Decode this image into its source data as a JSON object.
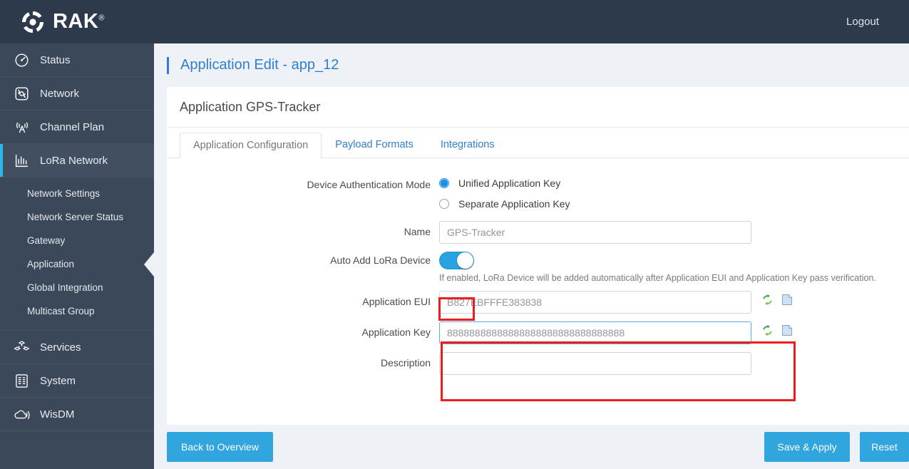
{
  "topbar": {
    "brand": "RAK",
    "brand_mark": "®",
    "logo_icon": "rak-swirl-logo-icon",
    "logout_label": "Logout"
  },
  "sidebar": {
    "items": [
      {
        "label": "Status",
        "icon": "speedometer-icon",
        "active": false
      },
      {
        "label": "Network",
        "icon": "globe-network-icon",
        "active": false
      },
      {
        "label": "Channel Plan",
        "icon": "antenna-tower-icon",
        "active": false
      },
      {
        "label": "LoRa Network",
        "icon": "bar-chart-icon",
        "active": true
      },
      {
        "label": "Services",
        "icon": "cubes-icon",
        "active": false
      },
      {
        "label": "System",
        "icon": "server-list-icon",
        "active": false
      },
      {
        "label": "WisDM",
        "icon": "cloud-signal-icon",
        "active": false
      }
    ],
    "subitems": [
      {
        "label": "Network Settings",
        "current": false
      },
      {
        "label": "Network Server Status",
        "current": false
      },
      {
        "label": "Gateway",
        "current": false
      },
      {
        "label": "Application",
        "current": true
      },
      {
        "label": "Global Integration",
        "current": false
      },
      {
        "label": "Multicast Group",
        "current": false
      }
    ]
  },
  "page": {
    "title": "Application Edit - app_12",
    "panel_heading": "Application GPS-Tracker"
  },
  "tabs": [
    {
      "label": "Application Configuration",
      "active": true
    },
    {
      "label": "Payload Formats",
      "active": false
    },
    {
      "label": "Integrations",
      "active": false
    }
  ],
  "form": {
    "auth_mode_label": "Device Authentication Mode",
    "auth_options": [
      {
        "label": "Unified Application Key",
        "selected": true
      },
      {
        "label": "Separate Application Key",
        "selected": false
      }
    ],
    "name_label": "Name",
    "name_value": "GPS-Tracker",
    "auto_add_label": "Auto Add LoRa Device",
    "auto_add_state": "on",
    "auto_add_hint": "If enabled, LoRa Device will be added automatically after Application EUI and Application Key pass verification.",
    "app_eui_label": "Application EUI",
    "app_eui_value": "B827EBFFFE383838",
    "app_key_label": "Application Key",
    "app_key_value": "88888888888888888888888888888888",
    "description_label": "Description",
    "description_value": "",
    "regen_icon": "refresh-generate-icon",
    "copy_icon": "copy-clipboard-icon"
  },
  "footer": {
    "back_label": "Back to Overview",
    "save_label": "Save & Apply",
    "reset_label": "Reset"
  },
  "colors": {
    "topbar": "#2c3a4c",
    "sidebar": "#3b4859",
    "accent_blue": "#31a5dd",
    "link_blue": "#2f7fd1",
    "annotation_red": "#ee1c1c",
    "toggle_on": "#29a3e0"
  }
}
